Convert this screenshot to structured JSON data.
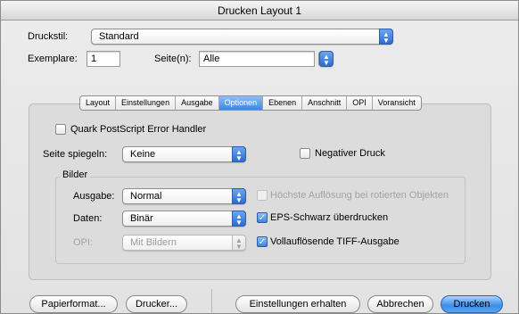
{
  "window": {
    "title": "Drucken Layout 1"
  },
  "top": {
    "druckstil_label": "Druckstil:",
    "druckstil_value": "Standard",
    "exemplare_label": "Exemplare:",
    "exemplare_value": "1",
    "seiten_label": "Seite(n):",
    "seiten_value": "Alle"
  },
  "tabs": [
    {
      "label": "Layout"
    },
    {
      "label": "Einstellungen"
    },
    {
      "label": "Ausgabe"
    },
    {
      "label": "Optionen",
      "active": true
    },
    {
      "label": "Ebenen"
    },
    {
      "label": "Anschnitt"
    },
    {
      "label": "OPI"
    },
    {
      "label": "Voransicht"
    }
  ],
  "options": {
    "quark_error_label": "Quark PostScript Error Handler",
    "quark_error_checked": false,
    "spiegeln_label": "Seite spiegeln:",
    "spiegeln_value": "Keine",
    "negativ_label": "Negativer Druck",
    "negativ_checked": false
  },
  "bilder": {
    "group_label": "Bilder",
    "ausgabe_label": "Ausgabe:",
    "ausgabe_value": "Normal",
    "daten_label": "Daten:",
    "daten_value": "Binär",
    "opi_label": "OPI:",
    "opi_value": "Mit Bildern",
    "hoechste_label": "Höchste Auflösung bei rotierten Objekten",
    "hoechste_checked": false,
    "eps_label": "EPS-Schwarz überdrucken",
    "eps_checked": true,
    "tiff_label": "Vollauflösende TIFF-Ausgabe",
    "tiff_checked": true
  },
  "buttons": {
    "papierformat": "Papierformat...",
    "drucker": "Drucker...",
    "einstellungen_erhalten": "Einstellungen erhalten",
    "abbrechen": "Abbrechen",
    "drucken": "Drucken"
  },
  "colors": {
    "accent": "#3f86e0",
    "default_button": "#3b8ee8"
  },
  "icons": {
    "popup_arrows": "updown-arrows-icon",
    "check": "checkmark-icon"
  }
}
